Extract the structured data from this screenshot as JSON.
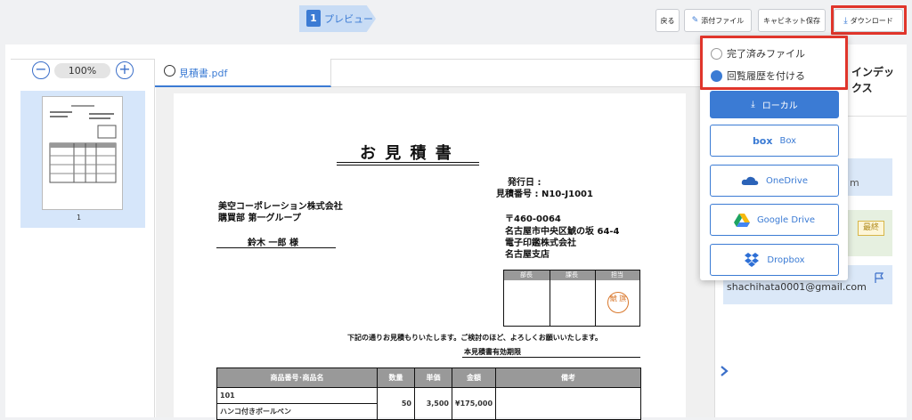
{
  "step": {
    "number": "1",
    "label": "プレビュー"
  },
  "toolbar": {
    "back": "戻る",
    "attach": "添付ファイル",
    "cabinet": "キャビネット保存",
    "download": "ダウンロード"
  },
  "zoom": {
    "minus": "−",
    "value": "100%",
    "plus": "+"
  },
  "thumbnail": {
    "page_number": "1"
  },
  "tab": {
    "file_name": "見積書.pdf"
  },
  "document": {
    "title": "お 見 積 書",
    "issue_date_label": "発行日 :",
    "estimate_no": "見積番号 : N10-J1001",
    "recipient_company": "美空コーポレーション株式会社",
    "recipient_dept": "購買部 第一グループ",
    "recipient_person": "鈴木 一郎 様",
    "sender_zip": "〒460-0064",
    "sender_address": "名古屋市中央区鯱の坂 64-4",
    "sender_company": "電子印鑑株式会社",
    "sender_branch": "名古屋支店",
    "stamp_headers": [
      "部長",
      "課長",
      "担当"
    ],
    "stamp_text": "鯱 旗",
    "intro": "下記の通りお見積もりいたします。ご検討のほど、よろしくお願いいたします。",
    "validity": "本見積書有効期限",
    "table_headers": [
      "商品番号･商品名",
      "数量",
      "単価",
      "金額",
      "備考"
    ],
    "rows": [
      {
        "name": "101",
        "qty": "",
        "price": "",
        "amount": "",
        "note": ""
      },
      {
        "name": "ハンコ付きボールペン",
        "qty": "50",
        "price": "3,500",
        "amount": "¥175,000",
        "note": ""
      }
    ]
  },
  "right_panel": {
    "title": "インデックス",
    "email_fragment": "m",
    "badge": "最終",
    "email": "shachihata0001@gmail.com"
  },
  "dropdown": {
    "options": [
      {
        "label": "完了済みファイル",
        "checked": false
      },
      {
        "label": "回覧履歴を付ける",
        "checked": true
      }
    ],
    "local_button": "ローカル",
    "services": [
      "Box",
      "OneDrive",
      "Google Drive",
      "Dropbox"
    ]
  },
  "colors": {
    "accent": "#3b7bd4",
    "highlight": "#e0352b"
  }
}
